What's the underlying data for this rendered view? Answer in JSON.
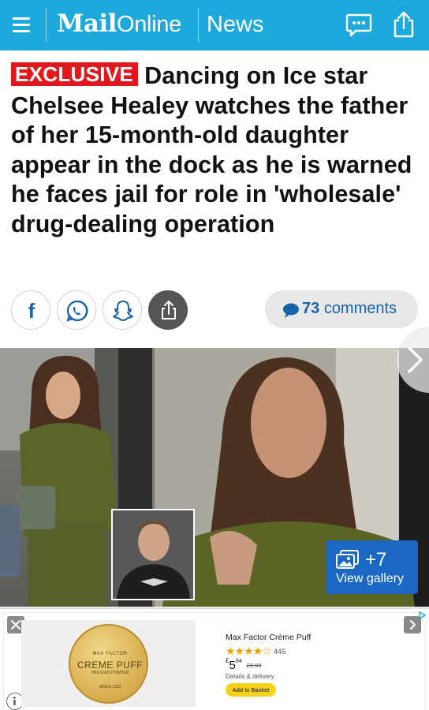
{
  "header": {
    "logo_mail": "Mail",
    "logo_online": "Online",
    "channel": "News",
    "background_color": "#1ea9dc"
  },
  "article": {
    "label": "EXCLUSIVE",
    "label_color": "#e2191c",
    "headline": "Dancing on Ice star Chelsee Healey watches the father of her 15-month-old daughter appear in the dock as he is warned he faces jail for role in 'wholesale' drug-dealing operation"
  },
  "share_bar": {
    "facebook": "f",
    "comments_count": "73",
    "comments_label": "comments",
    "icons": [
      "facebook-icon",
      "whatsapp-icon",
      "snapchat-icon",
      "share-icon",
      "comment-bubble-icon"
    ]
  },
  "gallery": {
    "count": "+7",
    "label": "View gallery"
  },
  "ad": {
    "product_title": "Max Factor Crème Puff",
    "stars": "★★★★☆",
    "rating_count": "445",
    "price_currency": "£",
    "price_whole": "5",
    "price_fraction": "94",
    "price_old": "£9.99",
    "delivery": "Details & delivery",
    "button": "Add to Basket",
    "compact_brand": "MAX FACTOR",
    "compact_name": "CREME PUFF",
    "compact_sub": "PRESSED POWDER",
    "compact_since": "SINCE 1933"
  }
}
